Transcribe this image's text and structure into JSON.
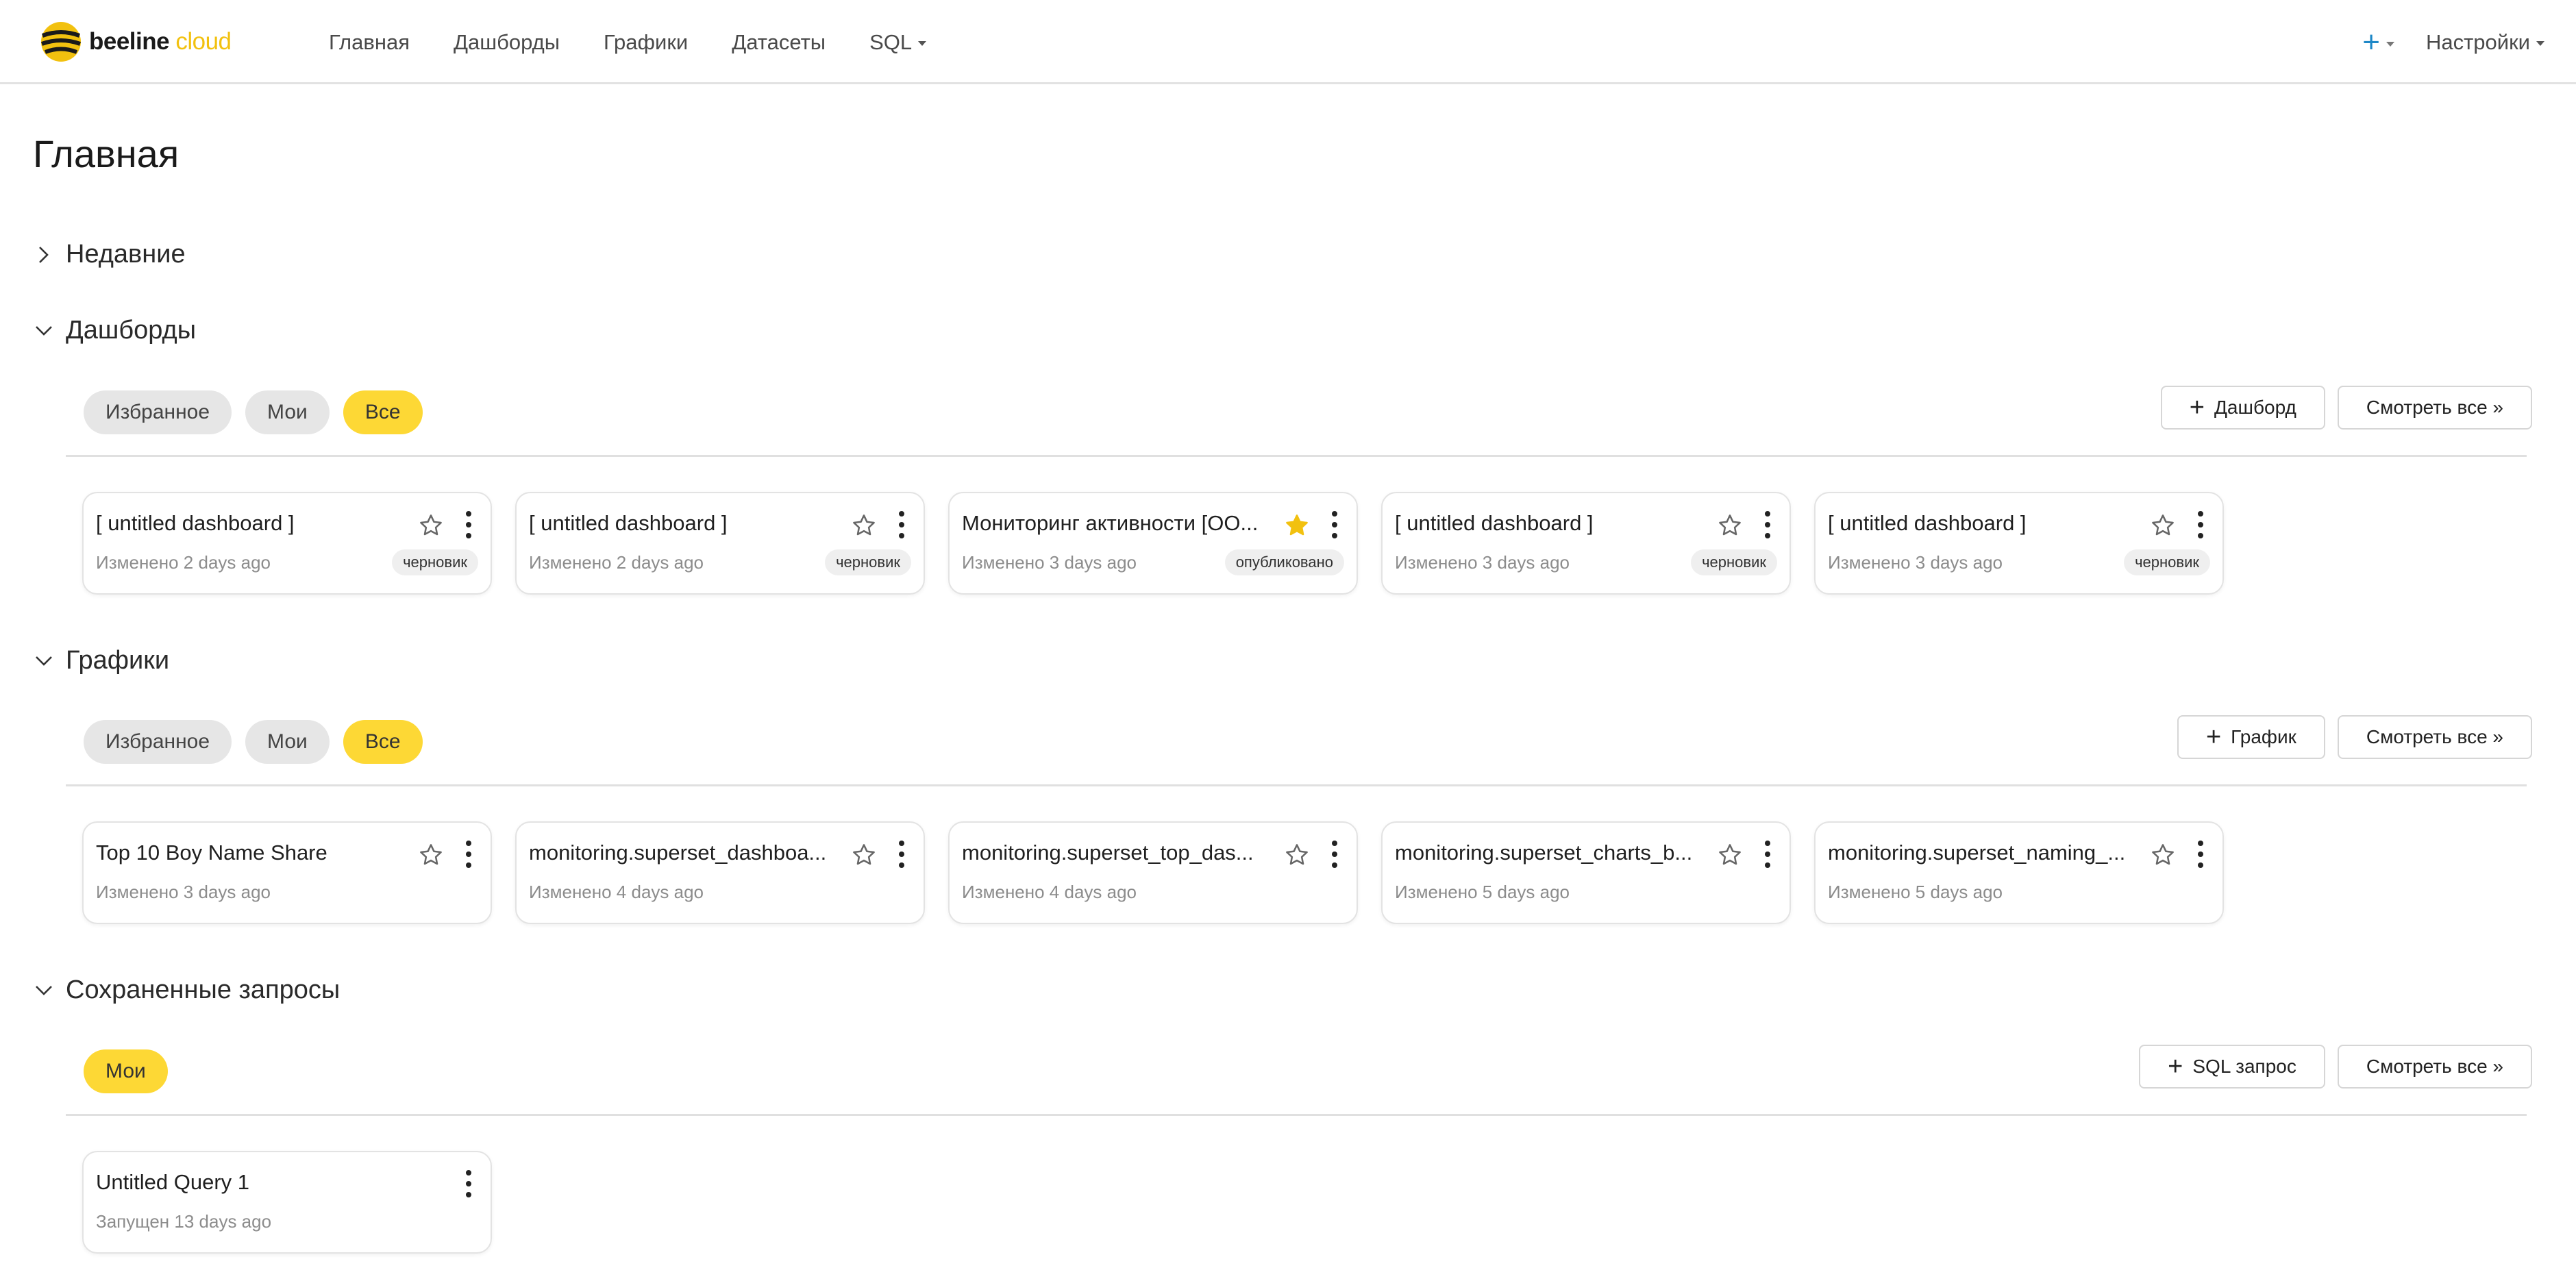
{
  "brand": {
    "name": "beeline",
    "suffix": "cloud",
    "colors": {
      "yellow": "#fdd835",
      "logo_yellow": "#f2c10f",
      "plus_blue": "#1e88c7"
    }
  },
  "nav": {
    "items": [
      {
        "label": "Главная"
      },
      {
        "label": "Дашборды"
      },
      {
        "label": "Графики"
      },
      {
        "label": "Датасеты"
      },
      {
        "label": "SQL"
      }
    ],
    "plus": "+",
    "settings": "Настройки"
  },
  "page_title": "Главная",
  "sections": {
    "recent": {
      "title": "Недавние"
    },
    "dashboards": {
      "title": "Дашборды",
      "filters": [
        "Избранное",
        "Мои",
        "Все"
      ],
      "active_filter": "Все",
      "add_button": "Дашборд",
      "view_all": "Смотреть все »",
      "cards": [
        {
          "title": "[ untitled dashboard ]",
          "meta": "Изменено 2 days ago",
          "badge": "черновик",
          "favorite": false
        },
        {
          "title": "[ untitled dashboard ]",
          "meta": "Изменено 2 days ago",
          "badge": "черновик",
          "favorite": false
        },
        {
          "title": "Мониторинг активности [ОО...",
          "meta": "Изменено 3 days ago",
          "badge": "опубликовано",
          "favorite": true
        },
        {
          "title": "[ untitled dashboard ]",
          "meta": "Изменено 3 days ago",
          "badge": "черновик",
          "favorite": false
        },
        {
          "title": "[ untitled dashboard ]",
          "meta": "Изменено 3 days ago",
          "badge": "черновик",
          "favorite": false
        }
      ]
    },
    "charts": {
      "title": "Графики",
      "filters": [
        "Избранное",
        "Мои",
        "Все"
      ],
      "active_filter": "Все",
      "add_button": "График",
      "view_all": "Смотреть все »",
      "cards": [
        {
          "title": "Top 10 Boy Name Share",
          "meta": "Изменено 3 days ago",
          "favorite": false
        },
        {
          "title": "monitoring.superset_dashboa...",
          "meta": "Изменено 4 days ago",
          "favorite": false
        },
        {
          "title": "monitoring.superset_top_das...",
          "meta": "Изменено 4 days ago",
          "favorite": false
        },
        {
          "title": "monitoring.superset_charts_b...",
          "meta": "Изменено 5 days ago",
          "favorite": false
        },
        {
          "title": "monitoring.superset_naming_...",
          "meta": "Изменено 5 days ago",
          "favorite": false
        }
      ]
    },
    "queries": {
      "title": "Сохраненные запросы",
      "filters": [
        "Мои"
      ],
      "active_filter": "Мои",
      "add_button": "SQL запрос",
      "view_all": "Смотреть все »",
      "cards": [
        {
          "title": "Untitled Query 1",
          "meta": "Запущен 13 days ago"
        }
      ]
    }
  },
  "icons": {
    "expand": "chevron-right-icon",
    "collapse": "chevron-down-icon",
    "star": "star-icon",
    "menu": "more-vertical-icon",
    "add": "plus-icon"
  }
}
